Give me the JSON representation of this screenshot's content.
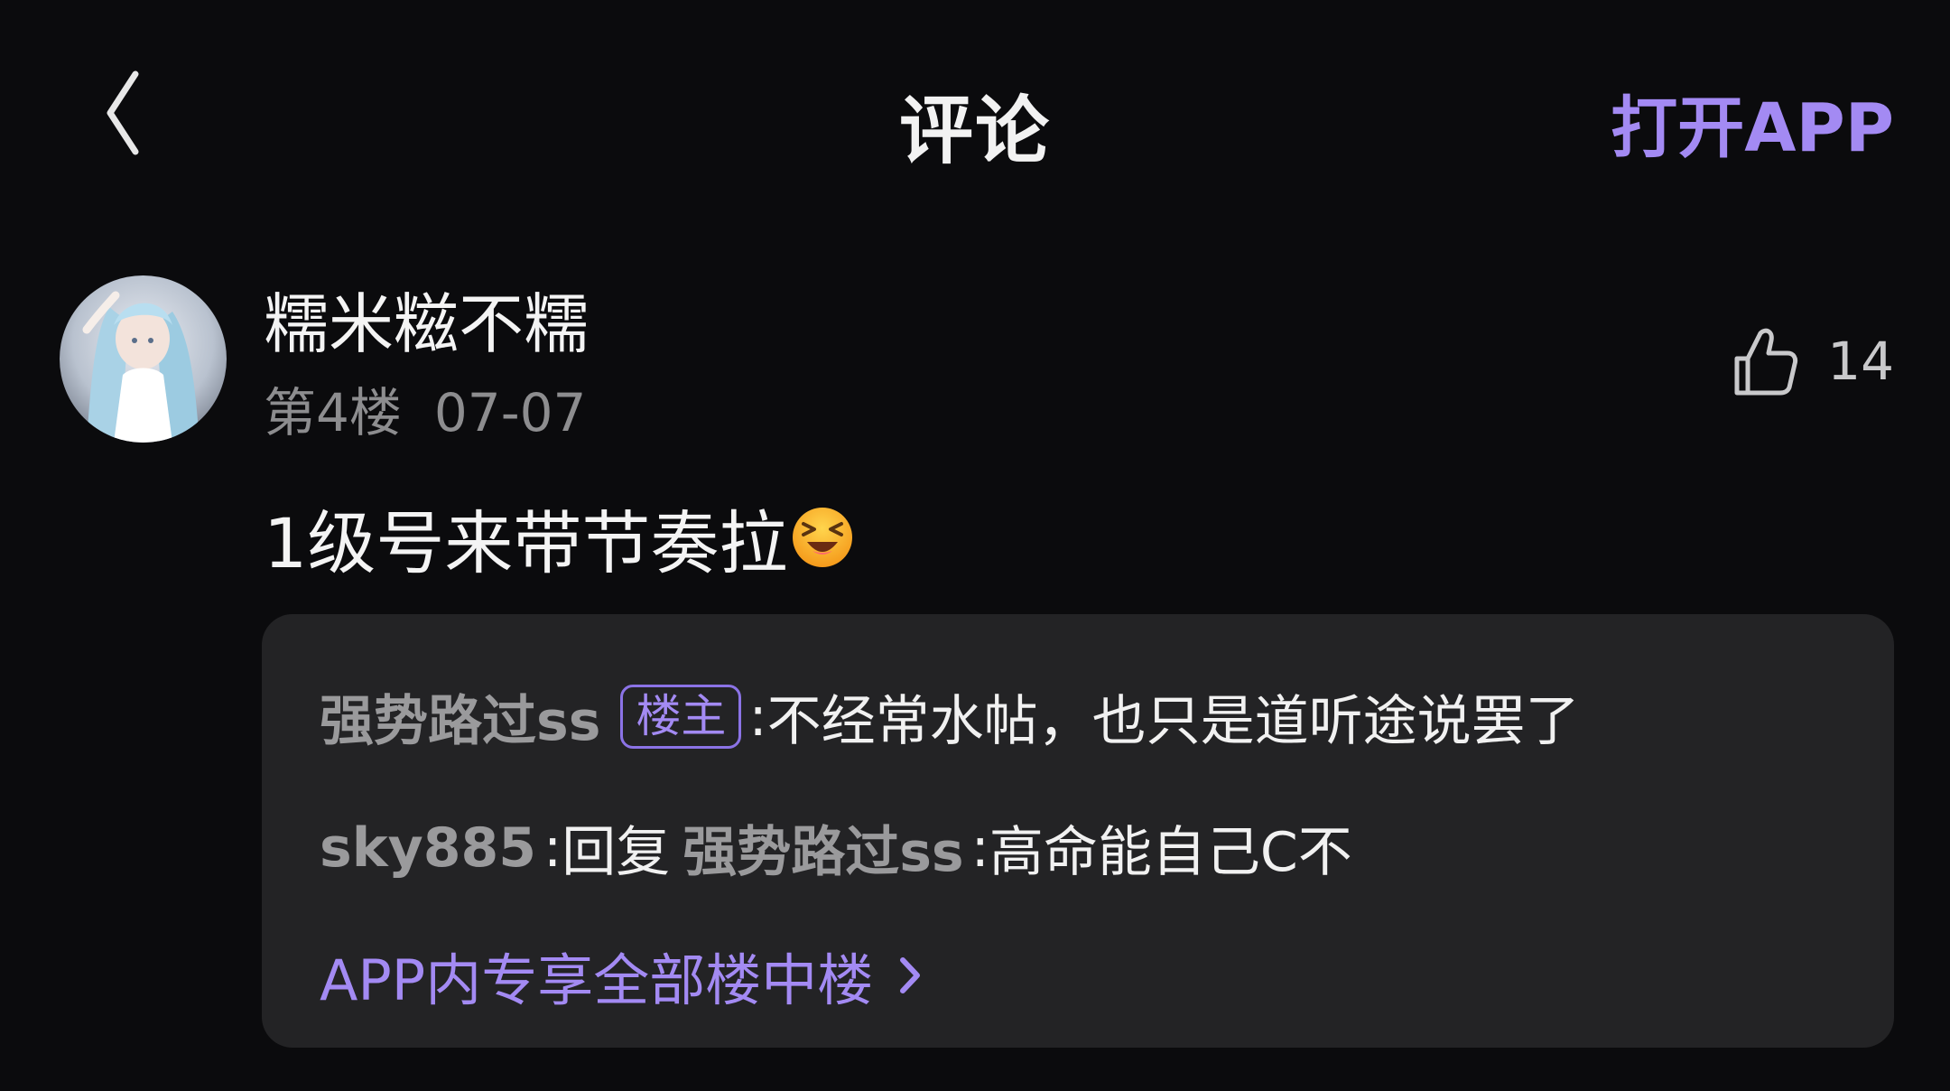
{
  "header": {
    "title": "评论",
    "open_app_label": "打开APP"
  },
  "comment": {
    "username": "糯米糍不糯",
    "floor": "第4楼",
    "date": "07-07",
    "likes": "14",
    "text": "1级号来带节奏拉",
    "emoji": "grinning-squint-emoji"
  },
  "replies": {
    "items": [
      {
        "author": "强势路过ss",
        "badge": "楼主",
        "separator": ":",
        "text": "不经常水帖，也只是道听途说罢了"
      },
      {
        "author": "sky885",
        "separator": " :",
        "reply_word": "回复",
        "reply_to": "强势路过ss",
        "text": "高命能自己C不"
      }
    ],
    "view_all_label": "APP内专享全部楼中楼"
  },
  "colors": {
    "background": "#0b0b0d",
    "accent": "#a38af3",
    "reply_box": "#232325",
    "muted_text": "#8d8d8f"
  }
}
